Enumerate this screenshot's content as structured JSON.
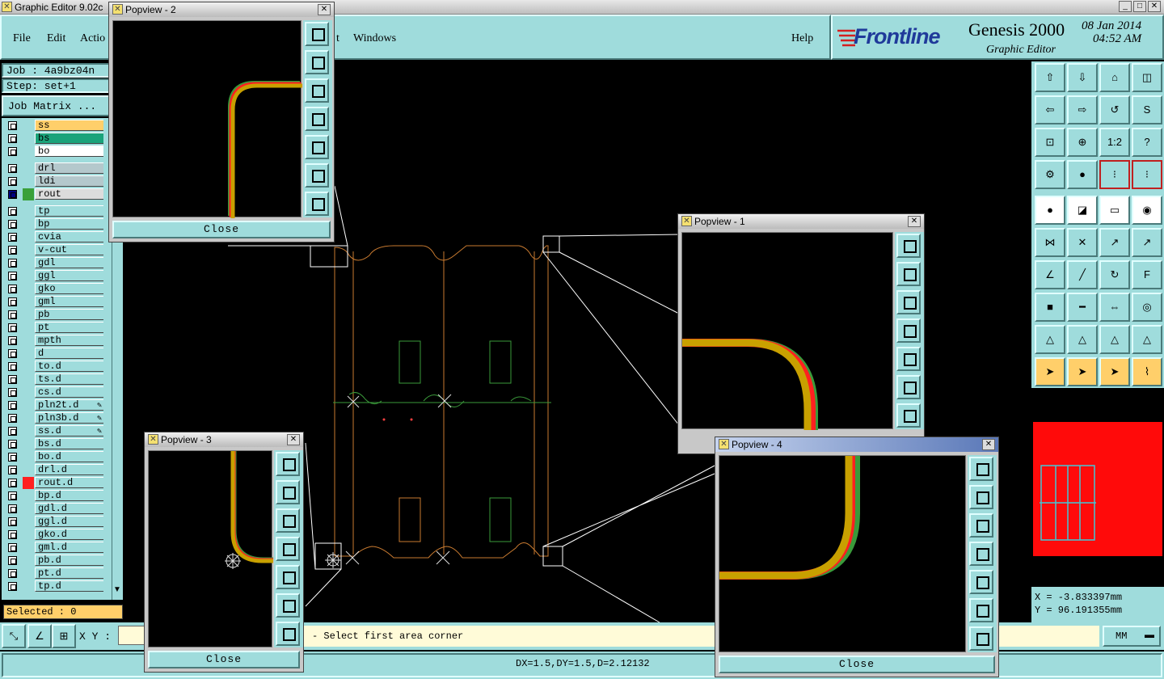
{
  "window": {
    "title": "Graphic Editor 9.02c"
  },
  "menu": {
    "file": "File",
    "edit": "Edit",
    "action": "Actio",
    "view_tail": "t",
    "windows": "Windows",
    "help": "Help"
  },
  "logo": {
    "brand": "Frontline",
    "product": "Genesis 2000",
    "module": "Graphic Editor",
    "date": "08 Jan 2014",
    "time": "04:52 AM"
  },
  "job": {
    "job_line": "Job : 4a9bz04n",
    "step_line": "Step: set+1",
    "matrix_button": "Job Matrix ..."
  },
  "layers": [
    {
      "name": "ss",
      "color": "#ffcf6a",
      "swatch": ""
    },
    {
      "name": "bs",
      "color": "#1aa37a",
      "swatch": ""
    },
    {
      "name": "bo",
      "color": "#ffffff",
      "swatch": ""
    },
    {
      "name": "drl",
      "color": "#b4c8cc",
      "swatch": ""
    },
    {
      "name": "ldi",
      "color": "#b4c8cc",
      "swatch": ""
    },
    {
      "name": "rout",
      "color": "#dcdcdc",
      "swatch": "#3aa03a",
      "box": "#000080"
    },
    {
      "name": "tp",
      "color": "#9fdcdc",
      "swatch": ""
    },
    {
      "name": "bp",
      "color": "#9fdcdc",
      "swatch": ""
    },
    {
      "name": "cvia",
      "color": "#9fdcdc",
      "swatch": ""
    },
    {
      "name": "v-cut",
      "color": "#9fdcdc",
      "swatch": ""
    },
    {
      "name": "gdl",
      "color": "#9fdcdc",
      "swatch": ""
    },
    {
      "name": "ggl",
      "color": "#9fdcdc",
      "swatch": ""
    },
    {
      "name": "gko",
      "color": "#9fdcdc",
      "swatch": ""
    },
    {
      "name": "gml",
      "color": "#9fdcdc",
      "swatch": ""
    },
    {
      "name": "pb",
      "color": "#9fdcdc",
      "swatch": ""
    },
    {
      "name": "pt",
      "color": "#9fdcdc",
      "swatch": ""
    },
    {
      "name": "mpth",
      "color": "#9fdcdc",
      "swatch": ""
    },
    {
      "name": "d",
      "color": "#9fdcdc",
      "swatch": ""
    },
    {
      "name": "to.d",
      "color": "#9fdcdc",
      "swatch": ""
    },
    {
      "name": "ts.d",
      "color": "#9fdcdc",
      "swatch": ""
    },
    {
      "name": "cs.d",
      "color": "#9fdcdc",
      "swatch": ""
    },
    {
      "name": "pln2t.d",
      "color": "#9fdcdc",
      "swatch": "",
      "mark": "✎"
    },
    {
      "name": "pln3b.d",
      "color": "#9fdcdc",
      "swatch": "",
      "mark": "✎"
    },
    {
      "name": "ss.d",
      "color": "#9fdcdc",
      "swatch": "",
      "mark": "✎"
    },
    {
      "name": "bs.d",
      "color": "#9fdcdc",
      "swatch": ""
    },
    {
      "name": "bo.d",
      "color": "#9fdcdc",
      "swatch": ""
    },
    {
      "name": "drl.d",
      "color": "#9fdcdc",
      "swatch": ""
    },
    {
      "name": "rout.d",
      "color": "#9fdcdc",
      "swatch": "#ff2020"
    },
    {
      "name": "bp.d",
      "color": "#9fdcdc",
      "swatch": ""
    },
    {
      "name": "gdl.d",
      "color": "#9fdcdc",
      "swatch": ""
    },
    {
      "name": "ggl.d",
      "color": "#9fdcdc",
      "swatch": ""
    },
    {
      "name": "gko.d",
      "color": "#9fdcdc",
      "swatch": ""
    },
    {
      "name": "gml.d",
      "color": "#9fdcdc",
      "swatch": ""
    },
    {
      "name": "pb.d",
      "color": "#9fdcdc",
      "swatch": ""
    },
    {
      "name": "pt.d",
      "color": "#9fdcdc",
      "swatch": ""
    },
    {
      "name": "tp.d",
      "color": "#9fdcdc",
      "swatch": ""
    }
  ],
  "selected": "Selected : 0",
  "status": {
    "xy_label": "X Y :",
    "message": "- Select first area corner",
    "measure": "DX=1.5,DY=1.5,D=2.12132",
    "units": "MM"
  },
  "coords": {
    "x": "X = -3.833397mm",
    "y": "Y = 96.191355mm"
  },
  "popviews": {
    "p1": "Popview - 1",
    "p2": "Popview - 2",
    "p3": "Popview - 3",
    "p4": "Popview - 4",
    "close": "Close"
  },
  "toolbar": {
    "scale": "1:2",
    "help": "?"
  }
}
